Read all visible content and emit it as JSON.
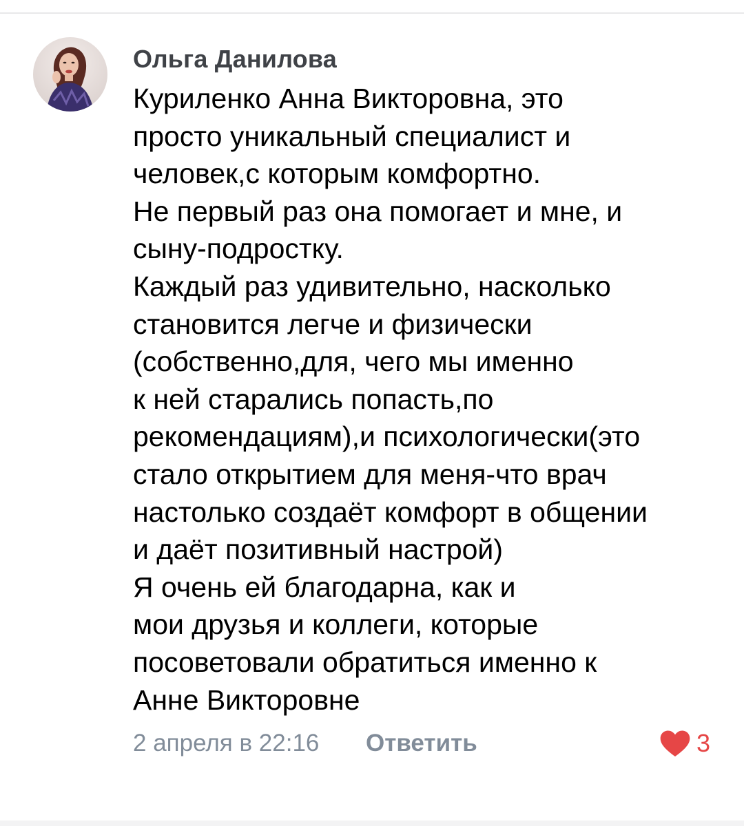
{
  "comment": {
    "author": "Ольга Данилова",
    "lines": [
      "Куриленко Анна Викторовна, это",
      "просто уникальный специалист и",
      "человек,с которым комфортно.",
      "Не первый раз она помогает и мне, и",
      "сыну-подростку.",
      "Каждый раз удивительно, насколько",
      "становится легче и физически",
      "(собственно,для, чего мы именно",
      "к ней старались попасть,по",
      "рекомендациям),и психологически(это",
      "стало открытием для меня-что врач",
      "настолько создаёт комфорт в общении",
      "и даёт позитивный настрой)",
      "Я очень ей благодарна, как и",
      "мои друзья и коллеги, которые",
      "посоветовали обратиться именно к",
      "Анне Викторовне"
    ],
    "timestamp": "2 апреля в 22:16",
    "reply_label": "Ответить",
    "like_count": "3",
    "like_icon": "heart-icon",
    "colors": {
      "author": "#3f4247",
      "meta": "#818c99",
      "like": "#e64646",
      "text": "#000000"
    }
  }
}
